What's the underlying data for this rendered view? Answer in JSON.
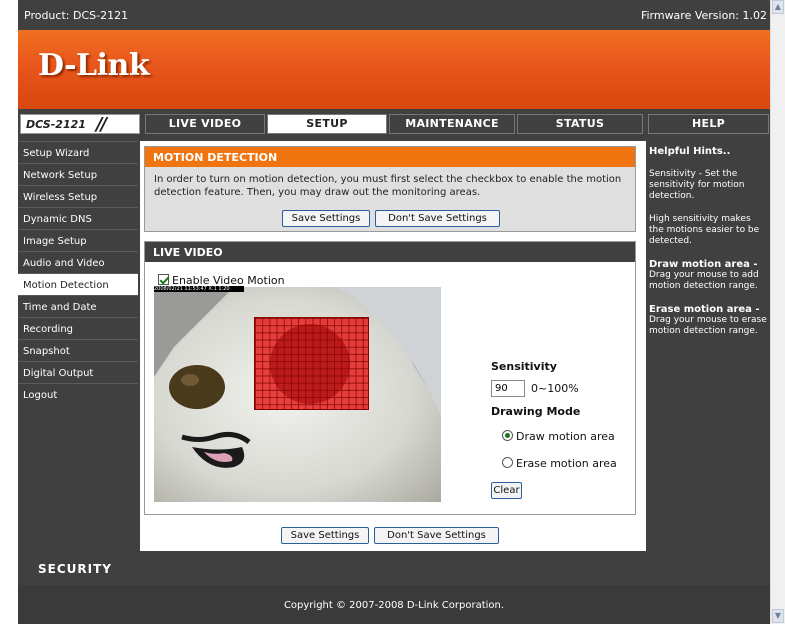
{
  "header": {
    "product": "Product: DCS-2121",
    "firmware": "Firmware Version: 1.02",
    "logo": "D-Link"
  },
  "model": "DCS-2121",
  "tabs": [
    {
      "label": "LIVE VIDEO"
    },
    {
      "label": "SETUP"
    },
    {
      "label": "MAINTENANCE"
    },
    {
      "label": "STATUS"
    },
    {
      "label": "HELP"
    }
  ],
  "sidebar": {
    "items": [
      {
        "label": "Setup Wizard"
      },
      {
        "label": "Network Setup"
      },
      {
        "label": "Wireless Setup"
      },
      {
        "label": "Dynamic DNS"
      },
      {
        "label": "Image Setup"
      },
      {
        "label": "Audio and Video"
      },
      {
        "label": "Motion Detection"
      },
      {
        "label": "Time and Date"
      },
      {
        "label": "Recording"
      },
      {
        "label": "Snapshot"
      },
      {
        "label": "Digital Output"
      },
      {
        "label": "Logout"
      }
    ]
  },
  "motion": {
    "title": "MOTION DETECTION",
    "text": "In order to turn on motion detection, you must first select the checkbox to enable the motion detection feature. Then, you may draw out the monitoring areas.",
    "save": "Save Settings",
    "dont_save": "Don't Save Settings"
  },
  "live": {
    "title": "LIVE VIDEO",
    "enable": "Enable Video Motion",
    "timestamp": "2008/02/21 11:53:47 X:1 1:20",
    "sensitivity_label": "Sensitivity",
    "sensitivity_value": "90",
    "sensitivity_range": "0~100%",
    "drawing_mode": "Drawing Mode",
    "draw": "Draw motion area",
    "erase": "Erase motion area",
    "clear": "Clear"
  },
  "bottom": {
    "save": "Save Settings",
    "dont_save": "Don't Save Settings"
  },
  "hints": {
    "title": "Helpful Hints..",
    "p1": "Sensitivity - Set the sensitivity for motion detection.",
    "p2": "High sensitivity makes the motions easier to be detected.",
    "h3": "Draw motion area -",
    "p3": "Drag your mouse to add motion detection range.",
    "h4": "Erase motion area -",
    "p4": "Drag your mouse to erase motion detection range."
  },
  "security": "SECURITY",
  "copyright": "Copyright © 2007-2008 D-Link Corporation.",
  "colors": {
    "orange": "#f0740f",
    "dark": "#404040"
  }
}
